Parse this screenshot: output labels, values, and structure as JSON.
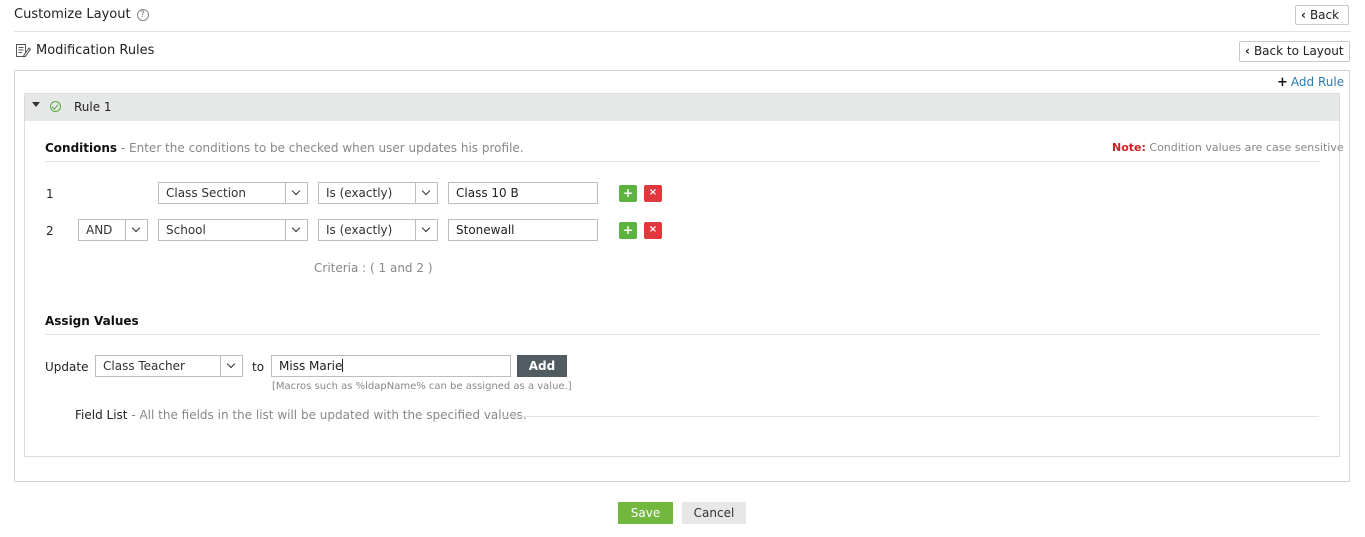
{
  "header": {
    "title": "Customize Layout",
    "help_icon": "?",
    "back_label": "Back",
    "back_to_layout_label": "Back to Layout"
  },
  "section": {
    "title": "Modification Rules",
    "add_rule_label": "Add Rule",
    "add_rule_icon": "+"
  },
  "rule": {
    "title": "Rule 1",
    "conditions": {
      "heading": "Conditions",
      "description": " - Enter the conditions to be checked when user updates his profile.",
      "note_label": "Note:",
      "note_text": " Condition values are case sensitive",
      "rows": [
        {
          "num": "1",
          "operator": "",
          "field": "Class Section",
          "comparator": "Is (exactly)",
          "value": "Class 10 B",
          "add_icon": "+",
          "remove_icon": "×"
        },
        {
          "num": "2",
          "operator": "AND",
          "field": "School",
          "comparator": "Is (exactly)",
          "value": "Stonewall",
          "add_icon": "+",
          "remove_icon": "×"
        }
      ],
      "criteria": "Criteria : ( 1 and 2 )"
    },
    "assign": {
      "heading": "Assign Values",
      "update_label": "Update",
      "field": "Class Teacher",
      "to_label": "to",
      "value": "Miss Marie",
      "add_label": "Add",
      "macro_hint": "[Macros such as %ldapName% can be assigned as a value.]",
      "field_list_label": "Field List",
      "field_list_desc": " - All the fields in the list will be updated with the specified values."
    }
  },
  "footer": {
    "save_label": "Save",
    "cancel_label": "Cancel"
  },
  "colors": {
    "link": "#2a7ab0",
    "save": "#72b83f",
    "add_green": "#5cb340",
    "remove_red": "#e0383f",
    "note_red": "#d02020",
    "add_button": "#515b62"
  }
}
